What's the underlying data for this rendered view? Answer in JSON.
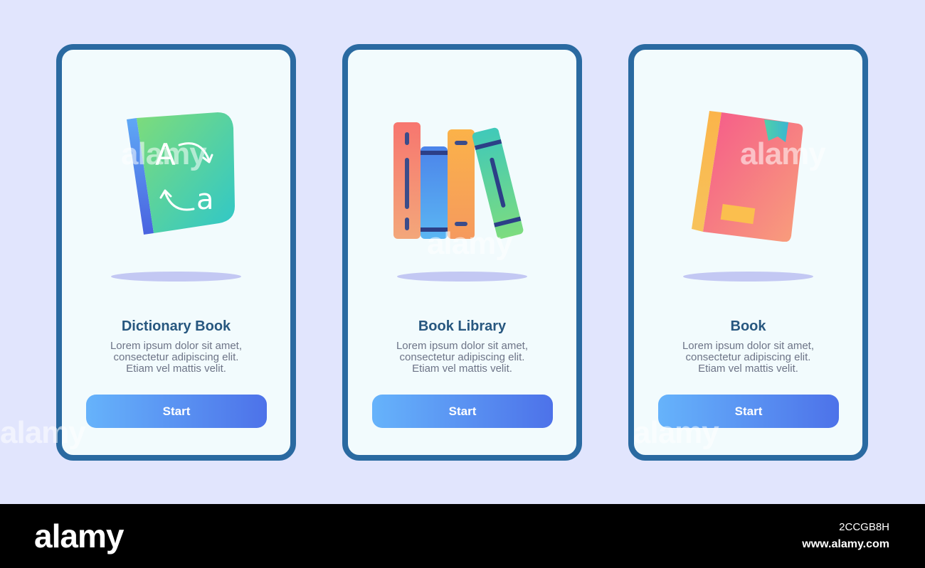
{
  "cards": [
    {
      "title": "Dictionary Book",
      "description": [
        "Lorem ipsum dolor sit amet,",
        "consectetur adipiscing elit.",
        "Etiam vel mattis velit."
      ],
      "button_label": "Start",
      "icon": "dictionary-book-icon",
      "icon_glyphs": [
        "A",
        "a"
      ]
    },
    {
      "title": "Book Library",
      "description": [
        "Lorem ipsum dolor sit amet,",
        "consectetur adipiscing elit.",
        "Etiam vel mattis velit."
      ],
      "button_label": "Start",
      "icon": "book-library-icon"
    },
    {
      "title": "Book",
      "description": [
        "Lorem ipsum dolor sit amet,",
        "consectetur adipiscing elit.",
        "Etiam vel mattis velit."
      ],
      "button_label": "Start",
      "icon": "book-icon"
    }
  ],
  "watermark": "alamy",
  "footer": {
    "logo": "alamy",
    "image_id": "2CCGB8H",
    "url": "www.alamy.com"
  },
  "colors": {
    "background": "#e1e5fd",
    "card_border": "#2a6aa1",
    "card_fill": "#f2fbfd",
    "title": "#27577f",
    "button_start": "#66b3fb",
    "button_end": "#4d72e9"
  }
}
